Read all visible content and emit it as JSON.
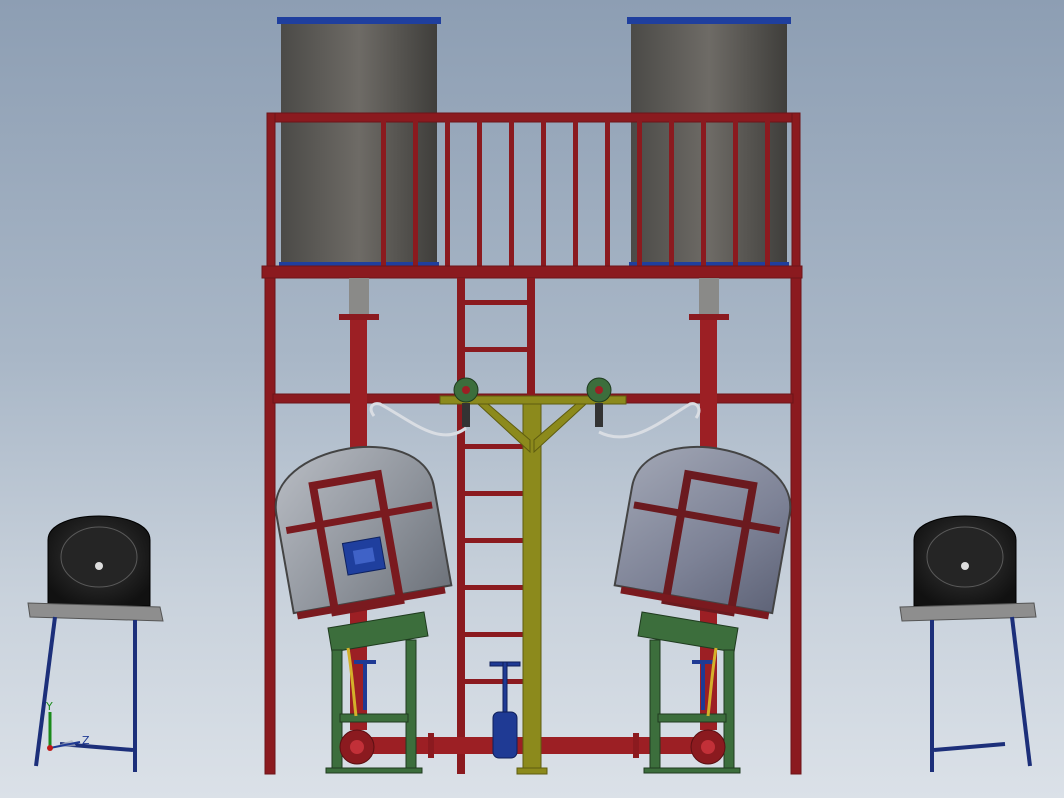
{
  "viewport": {
    "background_top": "#8d9eb3",
    "background_bottom": "#dbe1e8"
  },
  "colors": {
    "frame_red": "#8b1a1f",
    "tank_gray": "#5e5e5e",
    "tank_lid_blue": "#1f3f9e",
    "support_olive": "#8c8a1c",
    "stand_green": "#3c6e3c",
    "bowl_black": "#1e1e1e",
    "stand_blue": "#1c2f7a",
    "valve_blue": "#1f3a94",
    "hose_silver": "#d9dde3"
  },
  "triad": {
    "y_label": "Y",
    "z_label": "Z"
  },
  "icons": [
    "coordinate-triad-icon"
  ]
}
